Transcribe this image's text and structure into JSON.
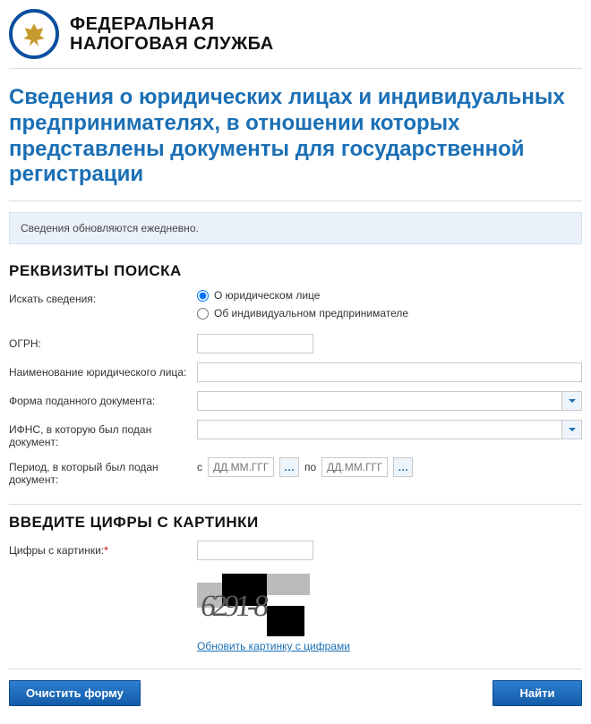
{
  "header": {
    "org_line1": "ФЕДЕРАЛЬНАЯ",
    "org_line2": "НАЛОГОВАЯ СЛУЖБА"
  },
  "page_title": "Сведения о юридических лицах и индивидуальных предпринимателях, в отношении которых представлены документы для государственной регистрации",
  "info_banner": "Сведения обновляются ежедневно.",
  "search": {
    "section_title": "РЕКВИЗИТЫ ПОИСКА",
    "label_subject": "Искать сведения:",
    "radio_legal": "О юридическом лице",
    "radio_individual": "Об индивидуальном предпринимателе",
    "label_ogrn": "ОГРН:",
    "label_name": "Наименование юридического лица:",
    "label_form": "Форма поданного документа:",
    "label_ifns": "ИФНС, в которую был подан документ:",
    "label_period": "Период, в который был подан документ:",
    "period_from": "с",
    "period_to": "по",
    "date_placeholder": "ДД.ММ.ГГГГ"
  },
  "captcha": {
    "section_title": "ВВЕДИТЕ ЦИФРЫ С КАРТИНКИ",
    "label": "Цифры с картинки:",
    "sample_text": "6291-8",
    "refresh": "Обновить картинку с цифрами"
  },
  "buttons": {
    "clear": "Очистить форму",
    "find": "Найти"
  }
}
